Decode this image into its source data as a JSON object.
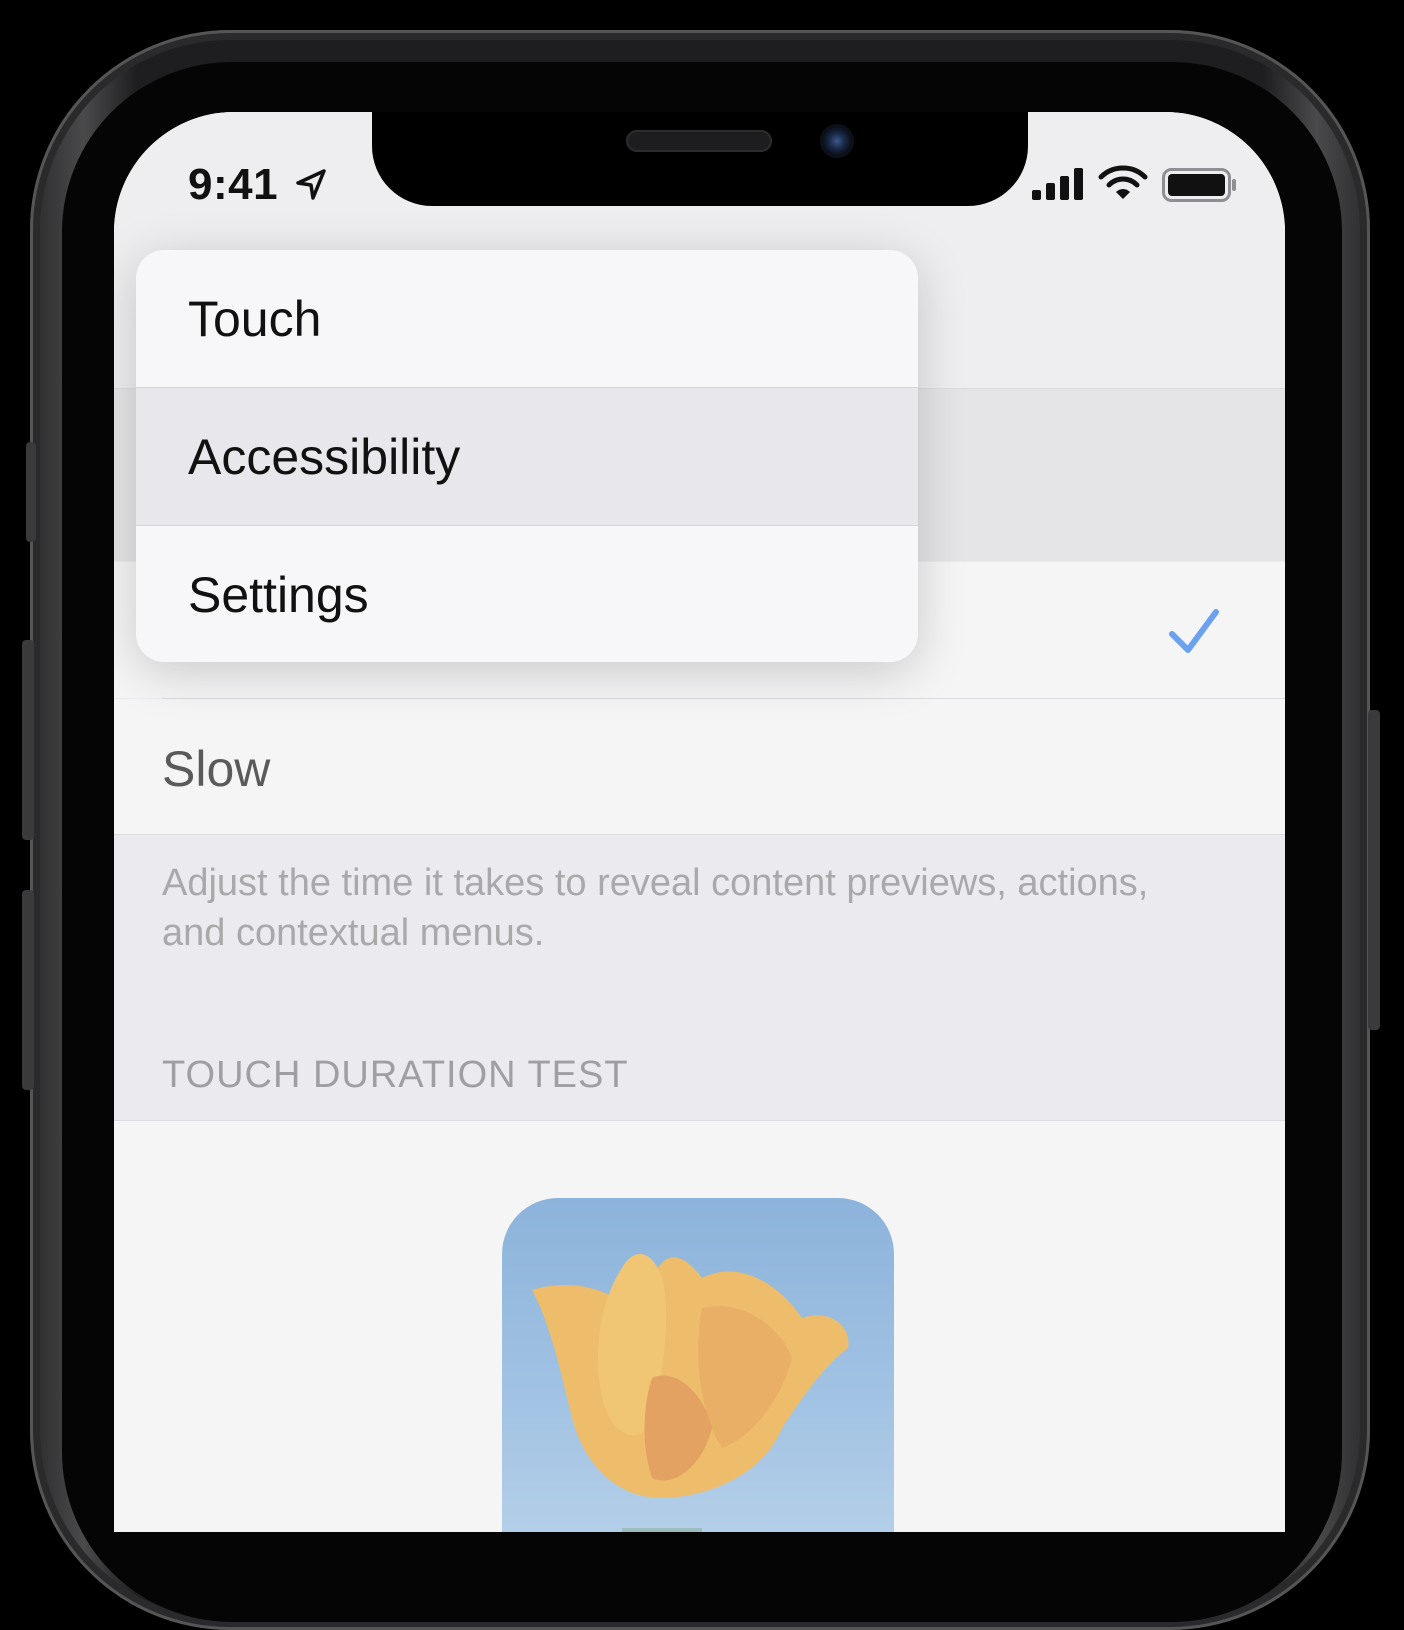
{
  "status_bar": {
    "time": "9:41"
  },
  "menu": {
    "items": [
      {
        "label": "Touch",
        "highlighted": false
      },
      {
        "label": "Accessibility",
        "highlighted": true
      },
      {
        "label": "Settings",
        "highlighted": false
      }
    ]
  },
  "settings": {
    "options": [
      {
        "label": "Slow",
        "checked": false
      }
    ],
    "footer": "Adjust the time it takes to reveal content previews, actions, and contextual menus.",
    "section_header": "TOUCH DURATION TEST"
  },
  "colors": {
    "accent": "#2b7ff3",
    "background": "#efeff4",
    "menu_background": "#f7f7f9",
    "menu_highlight": "#e8e8ec"
  },
  "icons": [
    "location-arrow-icon",
    "cellular-signal-icon",
    "wifi-icon",
    "battery-icon",
    "checkmark-icon"
  ]
}
